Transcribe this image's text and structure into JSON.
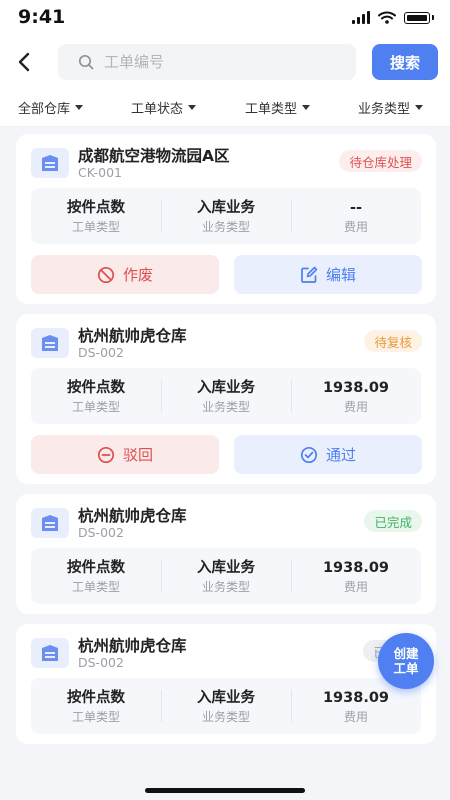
{
  "status": {
    "time": "9:41"
  },
  "search": {
    "placeholder": "工单编号",
    "button": "搜索"
  },
  "filters": [
    "全部仓库",
    "工单状态",
    "工单类型",
    "业务类型"
  ],
  "colors": {
    "accent": "#4f7ff0",
    "danger": "#e05353",
    "warning": "#e79a3c",
    "success": "#3fb366"
  },
  "cards": [
    {
      "name": "成都航空港物流园A区",
      "code": "CK-001",
      "badge": "待仓库处理",
      "stats": [
        {
          "value": "按件点数",
          "label": "工单类型"
        },
        {
          "value": "入库业务",
          "label": "业务类型"
        },
        {
          "value": "--",
          "label": "费用"
        }
      ],
      "actions": {
        "reject": "作废",
        "accept": "编辑"
      }
    },
    {
      "name": "杭州航帅虎仓库",
      "code": "DS-002",
      "badge": "待复核",
      "stats": [
        {
          "value": "按件点数",
          "label": "工单类型"
        },
        {
          "value": "入库业务",
          "label": "业务类型"
        },
        {
          "value": "1938.09",
          "label": "费用"
        }
      ],
      "actions": {
        "reject": "驳回",
        "accept": "通过"
      }
    },
    {
      "name": "杭州航帅虎仓库",
      "code": "DS-002",
      "badge": "已完成",
      "stats": [
        {
          "value": "按件点数",
          "label": "工单类型"
        },
        {
          "value": "入库业务",
          "label": "业务类型"
        },
        {
          "value": "1938.09",
          "label": "费用"
        }
      ]
    },
    {
      "name": "杭州航帅虎仓库",
      "code": "DS-002",
      "badge": "已",
      "stats": [
        {
          "value": "按件点数",
          "label": "工单类型"
        },
        {
          "value": "入库业务",
          "label": "业务类型"
        },
        {
          "value": "1938.09",
          "label": "费用"
        }
      ]
    }
  ],
  "fab": {
    "line1": "创建",
    "line2": "工单"
  }
}
